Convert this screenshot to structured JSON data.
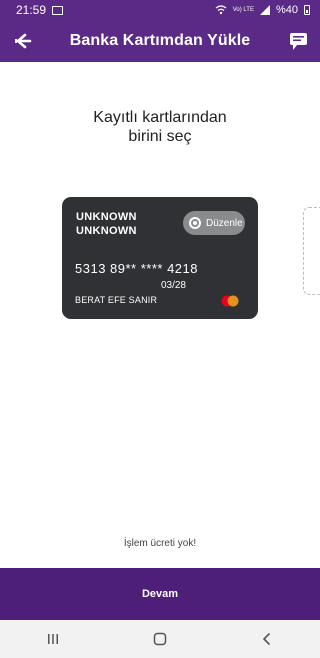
{
  "status_bar": {
    "time": "21:59",
    "lte_label": "Vo) LTE",
    "battery_text": "%40"
  },
  "app_bar": {
    "title": "Banka Kartımdan Yükle",
    "back_icon": "back-arrow-icon",
    "chat_icon": "chat-bubble-icon",
    "color": "#5b2a86"
  },
  "heading": {
    "line1": "Kayıtlı kartlarından",
    "line2": "birini seç"
  },
  "card": {
    "name_line1": "UNKNOWN",
    "name_line2": "UNKNOWN",
    "edit_label": "Düzenle",
    "number": "5313 89** **** 4218",
    "expiry": "03/28",
    "holder": "BERAT EFE SANIR",
    "brand": "mastercard",
    "background": "#2f3134"
  },
  "footer": {
    "fee_text": "İşlem ücreti yok!",
    "continue_label": "Devam",
    "continue_color": "#4e1f78"
  },
  "nav": {
    "recents_icon": "recents-icon",
    "home_icon": "home-icon",
    "back_icon": "back-icon"
  }
}
